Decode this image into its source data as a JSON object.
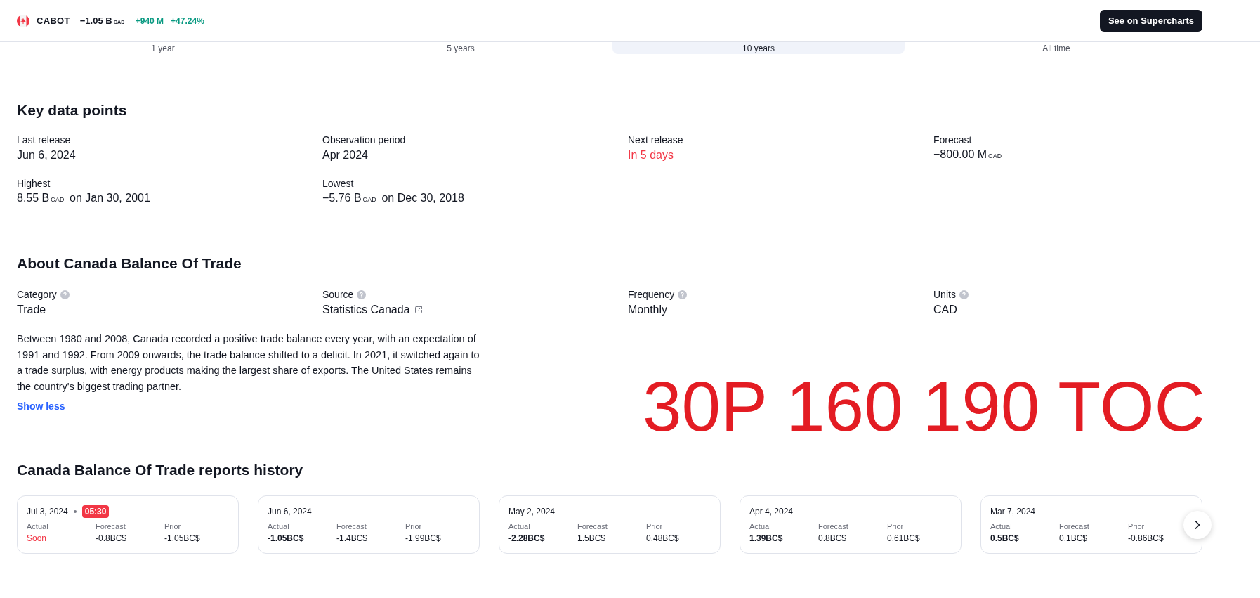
{
  "header": {
    "symbol": "CABOT",
    "value": "−1.05 B$_{CAD}$",
    "change": "+940 M",
    "change_percent": "+47.24%",
    "button": "See on Supercharts"
  },
  "period_tabs": [
    {
      "label": "1 year",
      "selected": false
    },
    {
      "label": "5 years",
      "selected": false
    },
    {
      "label": "10 years",
      "selected": true
    },
    {
      "label": "All time",
      "selected": false
    }
  ],
  "key_data": {
    "title": "Key data points",
    "items": [
      {
        "label": "Last release",
        "value": "Jun 6, 2024",
        "alert": false
      },
      {
        "label": "Observation period",
        "value": "Apr 2024",
        "alert": false
      },
      {
        "label": "Next release",
        "value": "In 5 days",
        "alert": true
      },
      {
        "label": "Forecast",
        "value": "−800.00 M$_{CAD}$",
        "alert": false
      },
      {
        "label": "Highest",
        "value": "8.55 B$_{CAD}$ on Jan 30, 2001",
        "alert": false
      },
      {
        "label": "Lowest",
        "value": "−5.76 B$_{CAD}$ on Dec 30, 2018",
        "alert": false
      }
    ]
  },
  "about": {
    "title": "About Canada Balance Of Trade",
    "fields": [
      {
        "kind": "text",
        "label": "Category",
        "value": "Trade"
      },
      {
        "kind": "link",
        "label": "Source",
        "value": "Statistics Canada"
      },
      {
        "kind": "text",
        "label": "Frequency",
        "value": "Monthly"
      },
      {
        "kind": "text",
        "label": "Units",
        "value": "CAD"
      }
    ],
    "description": "Between 1980 and 2008, Canada recorded a positive trade balance every year, with an expectation of 1991 and 1992. From 2009 onwards, the trade balance shifted to a deficit. In 2021, it switched again to a trade surplus, with energy products making the largest share of exports. The United States remains the country's biggest trading partner.",
    "toggle": "Show less"
  },
  "reports": {
    "title": "Canada Balance Of Trade reports history",
    "cards": [
      {
        "date": "Jul 3, 2024",
        "time": "05:30",
        "upcoming": true,
        "stats": [
          {
            "label": "Actual",
            "value": "Soon"
          },
          {
            "label": "Forecast",
            "value": "-0.8BC$"
          },
          {
            "label": "Prior",
            "value": "-1.05BC$"
          }
        ]
      },
      {
        "date": "Jun 6, 2024",
        "upcoming": false,
        "stats": [
          {
            "label": "Actual",
            "value": "-1.05BC$"
          },
          {
            "label": "Forecast",
            "value": "-1.4BC$"
          },
          {
            "label": "Prior",
            "value": "-1.99BC$"
          }
        ]
      },
      {
        "date": "May 2, 2024",
        "upcoming": false,
        "stats": [
          {
            "label": "Actual",
            "value": "-2.28BC$"
          },
          {
            "label": "Forecast",
            "value": "1.5BC$"
          },
          {
            "label": "Prior",
            "value": "0.48BC$"
          }
        ]
      },
      {
        "date": "Apr 4, 2024",
        "upcoming": false,
        "stats": [
          {
            "label": "Actual",
            "value": "1.39BC$"
          },
          {
            "label": "Forecast",
            "value": "0.8BC$"
          },
          {
            "label": "Prior",
            "value": "0.61BC$"
          }
        ]
      },
      {
        "date": "Mar 7, 2024",
        "upcoming": false,
        "stats": [
          {
            "label": "Actual",
            "value": "0.5BC$"
          },
          {
            "label": "Forecast",
            "value": "0.1BC$"
          },
          {
            "label": "Prior",
            "value": "-0.86BC$"
          }
        ]
      }
    ]
  },
  "annotation": {
    "text": "30P 160 190 TOC"
  }
}
